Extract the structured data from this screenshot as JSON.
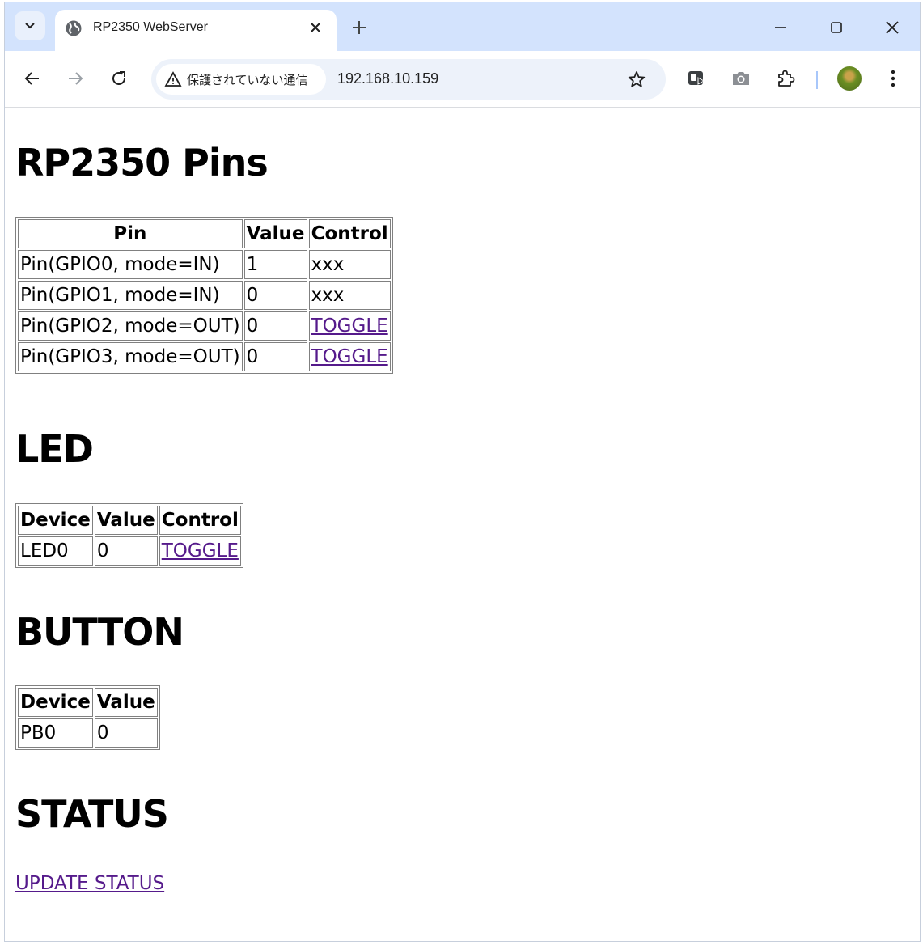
{
  "browser": {
    "tab_title": "RP2350 WebServer",
    "security_label": "保護されていない通信",
    "url": "192.168.10.159",
    "icons": [
      "tab-search-icon",
      "globe-icon",
      "close-icon",
      "plus-icon",
      "minimize-icon",
      "maximize-icon",
      "back-icon",
      "forward-icon",
      "reload-icon",
      "warning-icon",
      "star-icon",
      "cast-icon",
      "camera-icon",
      "extensions-icon",
      "avatar",
      "more-icon"
    ]
  },
  "page": {
    "pins_heading": "RP2350 Pins",
    "pins_table": {
      "headers": [
        "Pin",
        "Value",
        "Control"
      ],
      "rows": [
        {
          "pin": "Pin(GPIO0, mode=IN)",
          "value": "1",
          "control": "xxx"
        },
        {
          "pin": "Pin(GPIO1, mode=IN)",
          "value": "0",
          "control": "xxx"
        },
        {
          "pin": "Pin(GPIO2, mode=OUT)",
          "value": "0",
          "control": "TOGGLE"
        },
        {
          "pin": "Pin(GPIO3, mode=OUT)",
          "value": "0",
          "control": "TOGGLE"
        }
      ]
    },
    "led_heading": "LED",
    "led_table": {
      "headers": [
        "Device",
        "Value",
        "Control"
      ],
      "rows": [
        {
          "device": "LED0",
          "value": "0",
          "control": "TOGGLE"
        }
      ]
    },
    "button_heading": "BUTTON",
    "button_table": {
      "headers": [
        "Device",
        "Value"
      ],
      "rows": [
        {
          "device": "PB0",
          "value": "0"
        }
      ]
    },
    "status_heading": "STATUS",
    "update_link": "UPDATE STATUS"
  },
  "colors": {
    "tabstrip": "#d3e3fd",
    "link_visited": "#551a8b"
  }
}
